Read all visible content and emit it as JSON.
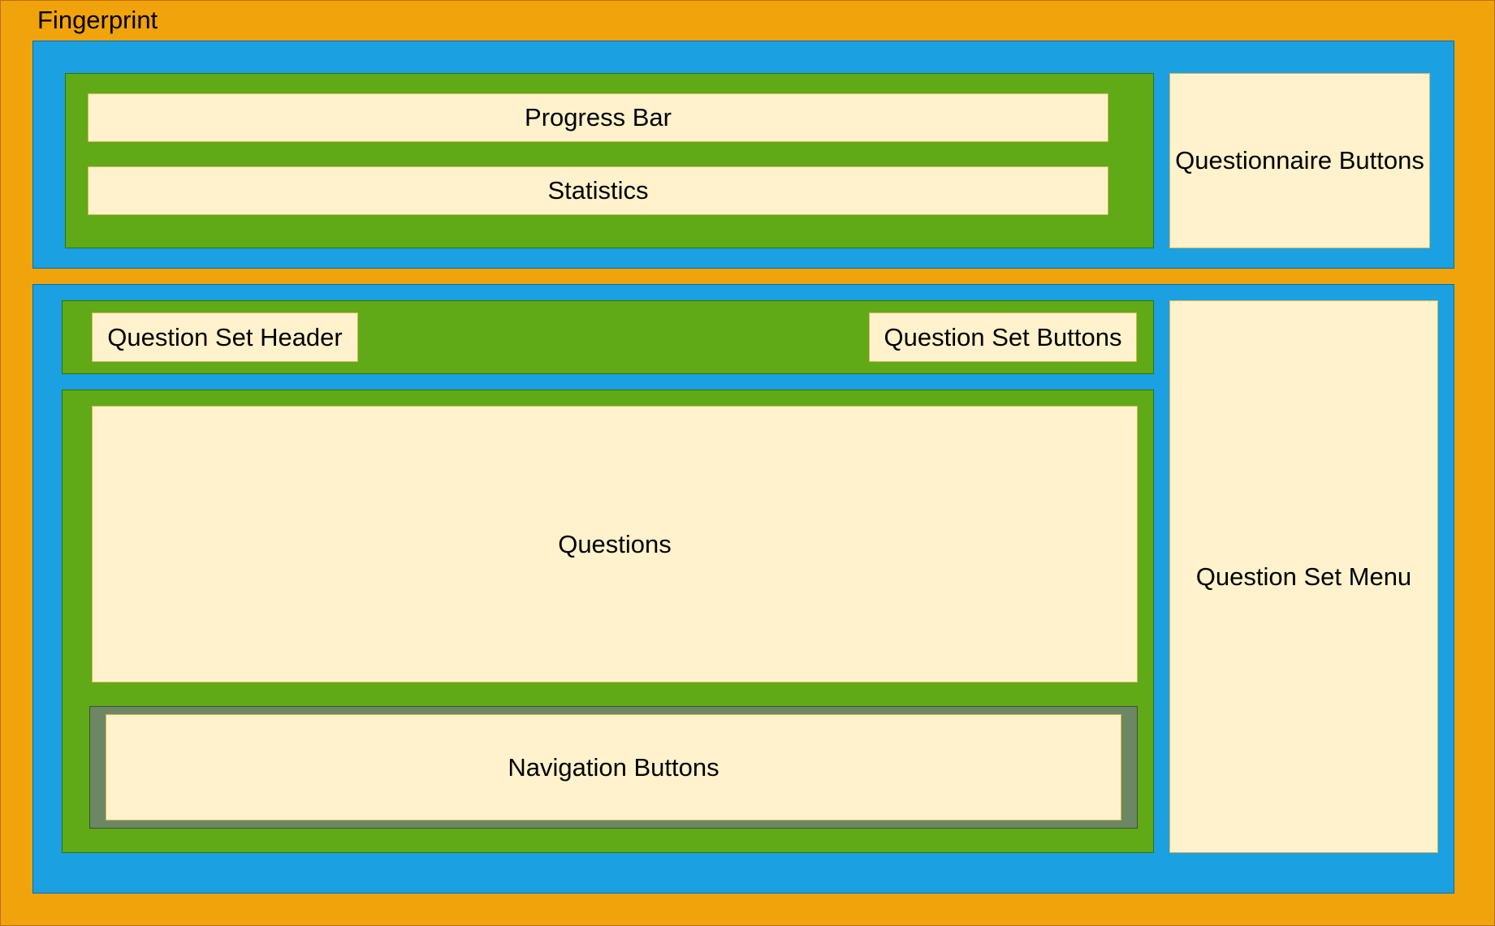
{
  "diagram": {
    "frame_title": "Fingerprint",
    "top_section": {
      "progress_bar": "Progress Bar",
      "statistics": "Statistics",
      "questionnaire_buttons": "Questionnaire Buttons"
    },
    "bottom_section": {
      "question_set_header": "Question Set Header",
      "question_set_buttons": "Question Set Buttons",
      "questions": "Questions",
      "navigation_buttons": "Navigation Buttons",
      "question_set_menu": "Question Set Menu"
    }
  },
  "colors": {
    "outer_frame": "#F0A30A",
    "section": "#1BA1E2",
    "group": "#60A917",
    "navigation_container": "#6D8764",
    "component": "#FFF2CC"
  }
}
